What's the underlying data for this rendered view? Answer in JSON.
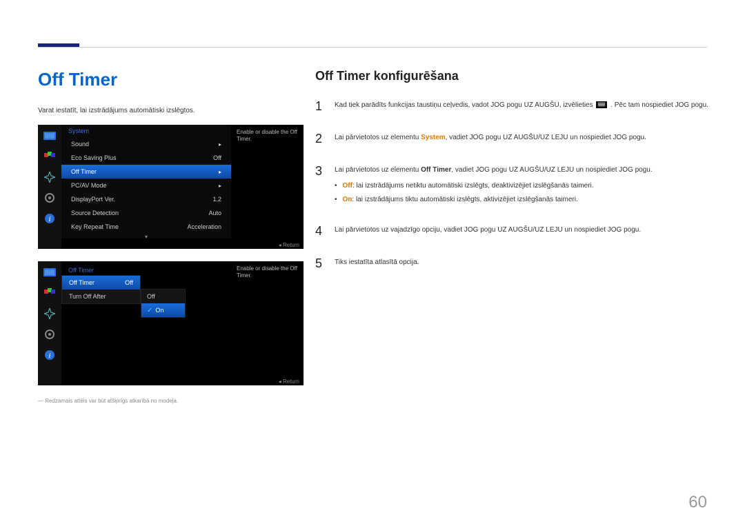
{
  "page_number": "60",
  "left": {
    "title": "Off Timer",
    "intro": "Varat iestatīt, lai izstrādājums automātiski izslēgtos.",
    "note": "― Redzamais attēls var būt atšķirīgs atkarībā no modeļa.",
    "osd1": {
      "title": "System",
      "hint": "Enable or disable the Off Timer.",
      "return": "Return",
      "rows": [
        {
          "label": "Sound",
          "value": "▸"
        },
        {
          "label": "Eco Saving Plus",
          "value": "Off"
        },
        {
          "label": "Off Timer",
          "value": "▸",
          "hl": true
        },
        {
          "label": "PC/AV Mode",
          "value": "▸"
        },
        {
          "label": "DisplayPort Ver.",
          "value": "1.2"
        },
        {
          "label": "Source Detection",
          "value": "Auto"
        },
        {
          "label": "Key Repeat Time",
          "value": "Acceleration"
        }
      ]
    },
    "osd2": {
      "title": "Off Timer",
      "hint": "Enable or disable the Off Timer.",
      "return": "Return",
      "rows": [
        {
          "label": "Off Timer",
          "value": "Off",
          "hl": true
        },
        {
          "label": "Turn Off After",
          "value": ""
        }
      ],
      "dropdown": [
        {
          "label": "Off"
        },
        {
          "label": "On",
          "hl": true,
          "check": true
        }
      ]
    }
  },
  "right": {
    "title": "Off Timer konfigurēšana",
    "steps": {
      "s1a": "Kad tiek parādīts funkcijas taustiņu ceļvedis, vadot JOG pogu UZ AUGŠU, izvēlieties",
      "s1b": ". Pēc tam nospiediet JOG pogu.",
      "s2a": "Lai pārvietotos uz elementu ",
      "s2kw": "System",
      "s2b": ", vadiet JOG pogu UZ AUGŠU/UZ LEJU un nospiediet JOG pogu.",
      "s3a": "Lai pārvietotos uz elementu ",
      "s3kw": "Off Timer",
      "s3b": ", vadiet JOG pogu UZ AUGŠU/UZ LEJU un nospiediet JOG pogu.",
      "b1kw": "Off",
      "b1": ": lai izstrādājums netiktu automātiski izslēgts, deaktivizējiet izslēgšanās taimeri.",
      "b2kw": "On",
      "b2": ": lai izstrādājums tiktu automātiski izslēgts, aktivizējiet izslēgšanās taimeri.",
      "s4": "Lai pārvietotos uz vajadzīgo opciju, vadiet JOG pogu UZ AUGŠU/UZ LEJU un nospiediet JOG pogu.",
      "s5": "Tiks iestatīta atlasītā opcija."
    },
    "nums": {
      "n1": "1",
      "n2": "2",
      "n3": "3",
      "n4": "4",
      "n5": "5"
    }
  }
}
